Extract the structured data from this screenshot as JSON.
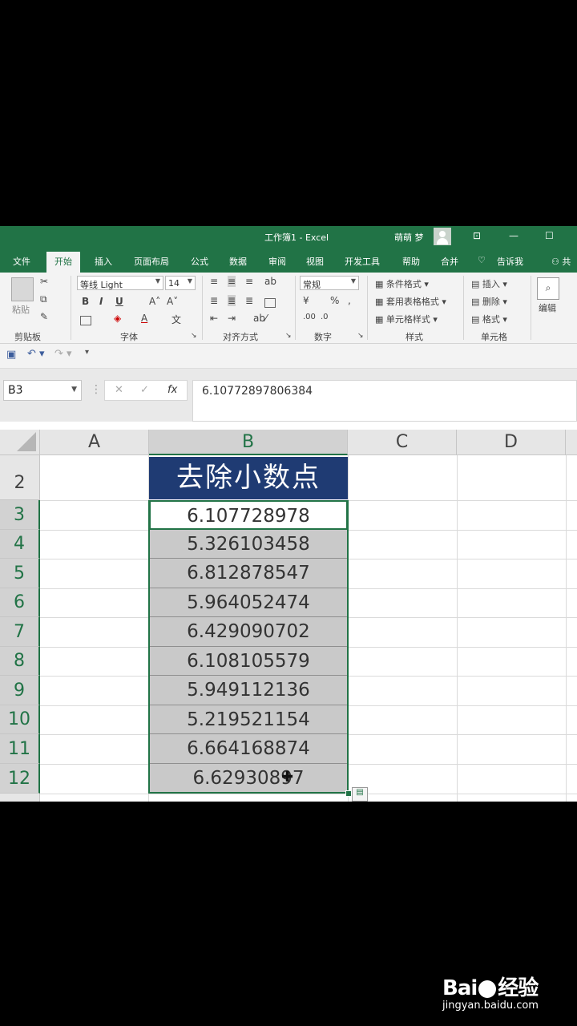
{
  "window": {
    "title": "工作簿1 - Excel",
    "user": "萌萌 梦"
  },
  "tabs": [
    "文件",
    "开始",
    "插入",
    "页面布局",
    "公式",
    "数据",
    "审阅",
    "视图",
    "开发工具",
    "帮助",
    "合并",
    "告诉我",
    "共"
  ],
  "active_tab": "开始",
  "ribbon": {
    "clipboard": {
      "label": "剪贴板",
      "paste": "粘贴"
    },
    "font": {
      "label": "字体",
      "name": "等线 Light",
      "size": "14",
      "bold": "B",
      "italic": "I",
      "underline": "U"
    },
    "alignment": {
      "label": "对齐方式"
    },
    "number": {
      "label": "数字",
      "format": "常规",
      "percent": "%"
    },
    "styles": {
      "label": "样式",
      "conditional": "条件格式",
      "table": "套用表格格式",
      "cell": "单元格样式"
    },
    "cells": {
      "label": "单元格",
      "insert": "插入",
      "delete": "删除",
      "format": "格式"
    },
    "editing": {
      "label": "编辑"
    }
  },
  "formula_bar": {
    "name_box": "B3",
    "formula": "6.10772897806384",
    "fx": "fx"
  },
  "columns": [
    "A",
    "B",
    "C",
    "D"
  ],
  "rows": [
    "2",
    "3",
    "4",
    "5",
    "6",
    "7",
    "8",
    "9",
    "10",
    "11",
    "12"
  ],
  "header_cell": "去除小数点",
  "values": [
    "6.107728978",
    "5.326103458",
    "6.812878547",
    "5.964052474",
    "6.429090702",
    "6.108105579",
    "5.949112136",
    "5.219521154",
    "6.664168874",
    "6.62930897"
  ],
  "watermark": {
    "logo_left": "Bai",
    "logo_right": "经验",
    "url": "jingyan.baidu.com"
  },
  "colors": {
    "excel_green": "#217346",
    "header_fill": "#1f3b73",
    "selection_fill": "#c9c9c9"
  }
}
